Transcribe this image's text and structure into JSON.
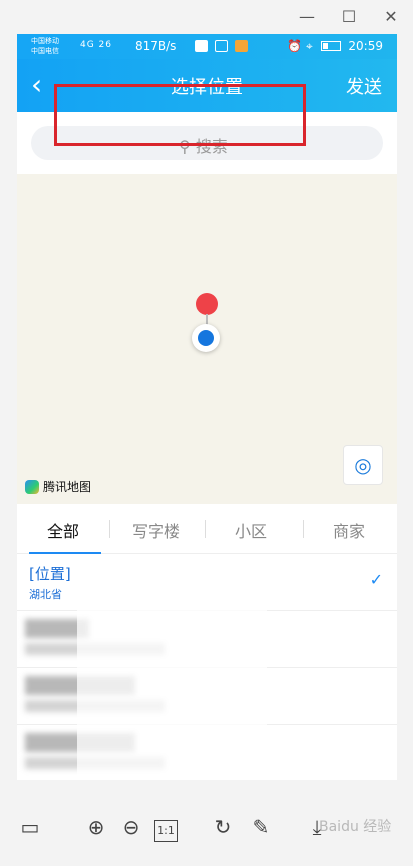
{
  "window": {
    "minimize_icon": "—",
    "maximize_icon": "☐",
    "close_icon": "✕"
  },
  "status_bar": {
    "carrier_1": "中国移动",
    "carrier_2": "中国电信",
    "signal": "4G 26",
    "speed": "817B/s",
    "time": "20:59"
  },
  "navbar": {
    "back_icon": "‹",
    "title": "选择位置",
    "send": "发送"
  },
  "search": {
    "placeholder": "搜索"
  },
  "map": {
    "logo_text": "腾讯地图",
    "locate_icon": "◎"
  },
  "tabs": [
    "全部",
    "写字楼",
    "小区",
    "商家"
  ],
  "results": [
    {
      "title": "[位置]",
      "subtitle": "湖北省",
      "selected": true
    }
  ],
  "toolbar": {
    "thumb_icon": "▭",
    "zoom_in_icon": "⊕",
    "zoom_out_icon": "⊖",
    "fit_label": "1:1",
    "rotate_icon": "↻",
    "edit_icon": "✎",
    "download_icon": "⤓",
    "watermark": "Baidu 经验"
  }
}
